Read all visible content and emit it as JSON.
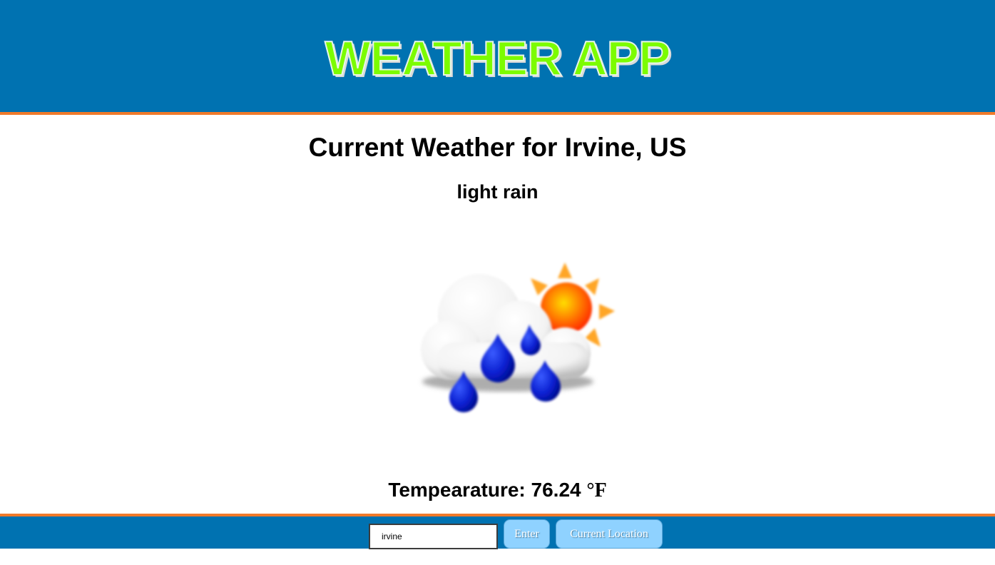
{
  "header": {
    "app_title": "WEATHER APP",
    "background_color": "#0072b1",
    "accent_color": "#f07a2a",
    "title_color": "#7cfc00"
  },
  "weather": {
    "location_title": "Current Weather for Irvine, US",
    "description": "light rain",
    "icon": "light-rain-partly-sunny-icon",
    "temperature_label": "Tempearature: 76.24",
    "temperature_unit": "°F"
  },
  "footer": {
    "city_input_value": "irvine",
    "enter_label": "Enter",
    "current_location_label": "Current Location"
  }
}
